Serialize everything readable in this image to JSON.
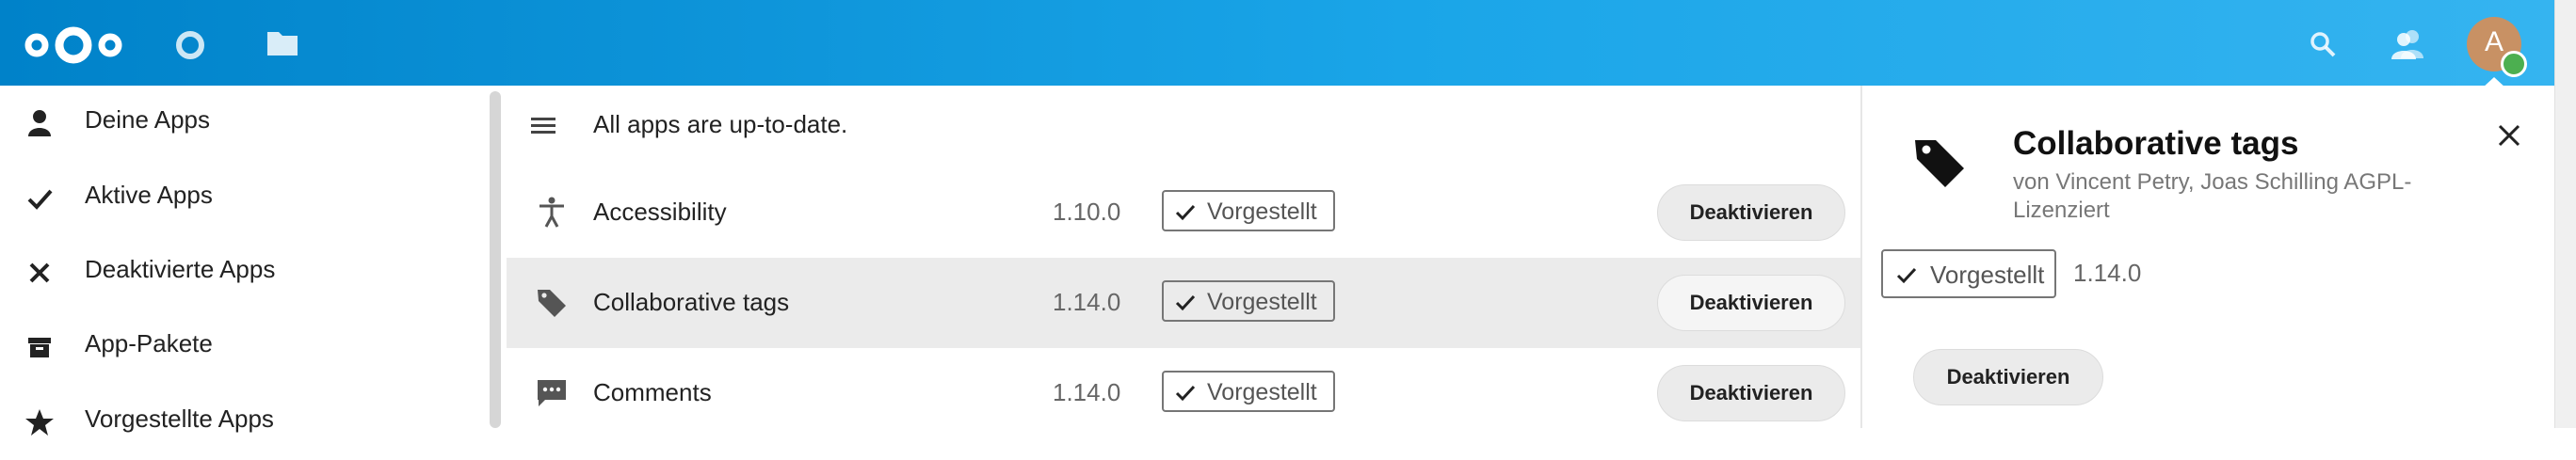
{
  "header": {
    "logo": "nextcloud-logo",
    "apps": [
      {
        "icon": "dashboard-circle-icon"
      },
      {
        "icon": "files-folder-icon"
      }
    ],
    "right_icons": [
      "search-icon",
      "contacts-icon"
    ],
    "avatar": {
      "initial": "A",
      "status": "online"
    },
    "colors": {
      "gradient_start": "#0082c9",
      "gradient_end": "#35b4f0",
      "avatar": "#c89164",
      "status": "#4caf50"
    }
  },
  "nav": {
    "items": [
      {
        "label": "Deine Apps",
        "icon": "person-icon"
      },
      {
        "label": "Aktive Apps",
        "icon": "check-icon"
      },
      {
        "label": "Deaktivierte Apps",
        "icon": "close-icon"
      },
      {
        "label": "App-Pakete",
        "icon": "archive-icon"
      },
      {
        "label": "Vorgestellte Apps",
        "icon": "star-icon"
      }
    ]
  },
  "main": {
    "status": "All apps are up-to-date.",
    "rows": [
      {
        "name": "Accessibility",
        "version": "1.10.0",
        "badge": "Vorgestellt",
        "action": "Deaktivieren",
        "icon": "accessibility-icon",
        "selected": false
      },
      {
        "name": "Collaborative tags",
        "version": "1.14.0",
        "badge": "Vorgestellt",
        "action": "Deaktivieren",
        "icon": "tag-icon",
        "selected": true
      },
      {
        "name": "Comments",
        "version": "1.14.0",
        "badge": "Vorgestellt",
        "action": "Deaktivieren",
        "icon": "comment-icon",
        "selected": false
      }
    ]
  },
  "detail": {
    "title": "Collaborative tags",
    "authors": "von Vincent Petry, Joas Schilling AGPL-Lizenziert",
    "badge": "Vorgestellt",
    "version": "1.14.0",
    "action": "Deaktivieren"
  }
}
